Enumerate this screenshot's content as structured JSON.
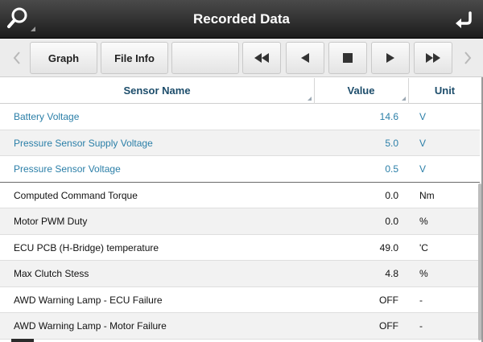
{
  "header": {
    "title": "Recorded Data",
    "search_icon": "search-magnifier-icon",
    "back_icon": "return-arrow-icon"
  },
  "toolbar": {
    "graph_label": "Graph",
    "fileinfo_label": "File Info",
    "blank_label": "",
    "prev_arrow_icon": "chevron-left-icon",
    "next_arrow_icon": "chevron-right-icon",
    "rewind_icon": "rewind-icon",
    "step_back_icon": "step-back-icon",
    "stop_icon": "stop-icon",
    "play_icon": "play-icon",
    "fast_forward_icon": "fast-forward-icon"
  },
  "columns": {
    "name": "Sensor Name",
    "value": "Value",
    "unit": "Unit"
  },
  "rows": [
    {
      "name": "Battery Voltage",
      "value": "14.6",
      "unit": "V"
    },
    {
      "name": "Pressure Sensor Supply Voltage",
      "value": "5.0",
      "unit": "V"
    },
    {
      "name": "Pressure Sensor Voltage",
      "value": "0.5",
      "unit": "V"
    },
    {
      "name": "Computed Command Torque",
      "value": "0.0",
      "unit": "Nm"
    },
    {
      "name": "Motor PWM Duty",
      "value": "0.0",
      "unit": "%"
    },
    {
      "name": "ECU PCB (H-Bridge) temperature",
      "value": "49.0",
      "unit": "'C"
    },
    {
      "name": "Max Clutch Stess",
      "value": "4.8",
      "unit": "%"
    },
    {
      "name": "AWD Warning Lamp - ECU Failure",
      "value": "OFF",
      "unit": "-"
    },
    {
      "name": "AWD Warning Lamp - Motor Failure",
      "value": "OFF",
      "unit": "-"
    }
  ],
  "colors": {
    "highlight_text": "#2b7fa8",
    "header_text": "#1d4d6b",
    "titlebar": "#2a2a2a"
  }
}
